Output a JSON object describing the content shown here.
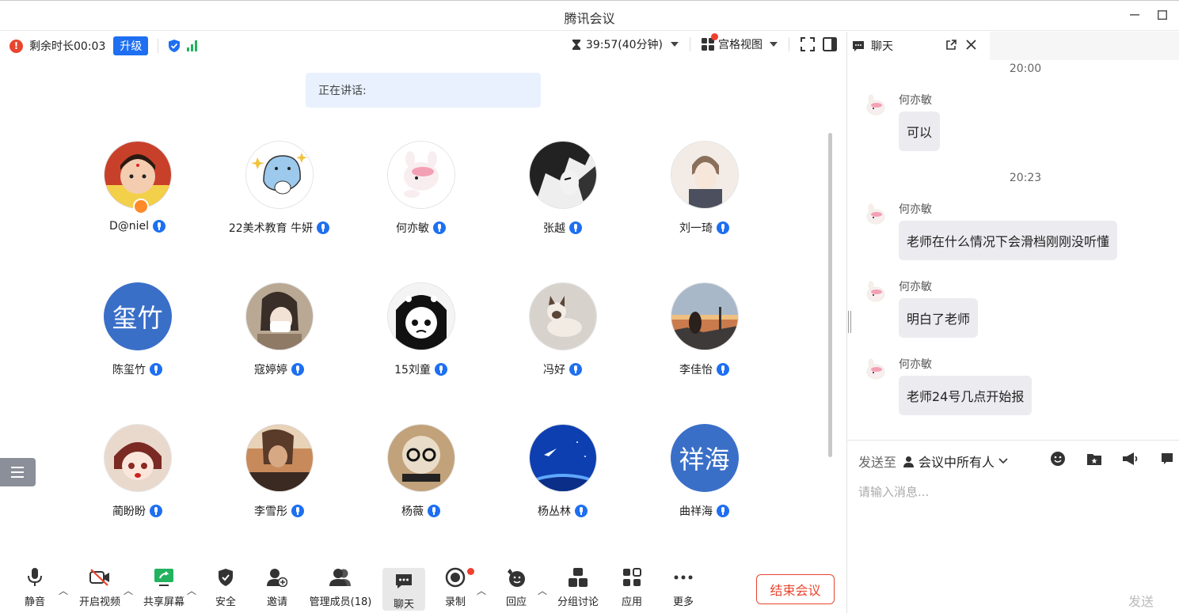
{
  "window": {
    "title": "腾讯会议"
  },
  "status": {
    "remaining": "剩余时长00:03",
    "upgrade": "升级",
    "timer": "39:57(40分钟)",
    "view": "宫格视图"
  },
  "speaking": {
    "label": "正在讲话:"
  },
  "participants": [
    {
      "name": "D@niel"
    },
    {
      "name": "22美术教育 牛妍"
    },
    {
      "name": "何亦敏"
    },
    {
      "name": "张越"
    },
    {
      "name": "刘一琦"
    },
    {
      "name": "陈玺竹",
      "initials": "玺竹"
    },
    {
      "name": "寇婷婷"
    },
    {
      "name": "15刘童"
    },
    {
      "name": "冯好"
    },
    {
      "name": "李佳怡"
    },
    {
      "name": "蔺盼盼"
    },
    {
      "name": "李雪彤"
    },
    {
      "name": "杨薇"
    },
    {
      "name": "杨丛林"
    },
    {
      "name": "曲祥海",
      "initials": "祥海"
    }
  ],
  "toolbar": {
    "mute": "静音",
    "video": "开启视频",
    "share": "共享屏幕",
    "security": "安全",
    "invite": "邀请",
    "members": "管理成员(18)",
    "chat": "聊天",
    "record": "录制",
    "react": "回应",
    "breakout": "分组讨论",
    "apps": "应用",
    "more": "更多",
    "end": "结束会议"
  },
  "chat": {
    "tab": "聊天",
    "ts1": "20:00",
    "ts2": "20:23",
    "messages": [
      {
        "sender": "何亦敏",
        "text": "可以"
      },
      {
        "sender": "何亦敏",
        "text": "老师在什么情况下会滑档刚刚没听懂"
      },
      {
        "sender": "何亦敏",
        "text": "明白了老师"
      },
      {
        "sender": "何亦敏",
        "text": "老师24号几点开始报"
      }
    ],
    "sendto_label": "发送至",
    "sendto_target": "会议中所有人",
    "placeholder": "请输入消息...",
    "send": "发送"
  },
  "colors": {
    "accent": "#1e6ff1",
    "danger": "#e8452f",
    "signal": "#22b35e"
  }
}
